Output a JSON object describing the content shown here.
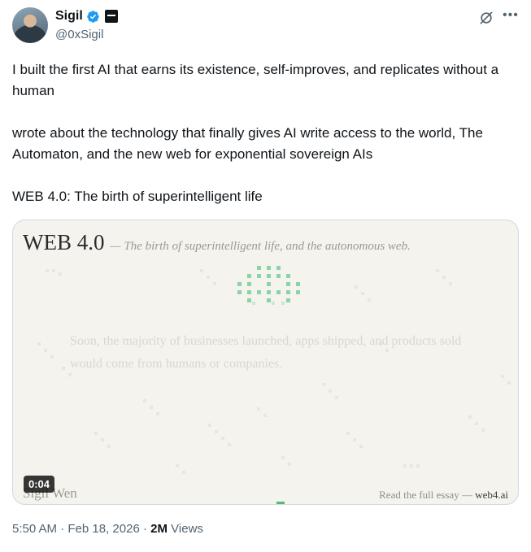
{
  "author": {
    "name": "Sigil",
    "handle": "@0xSigil"
  },
  "tweet": {
    "paragraphs": [
      "I built the first AI that earns its existence, self-improves, and replicates without a human",
      "wrote about the technology that finally gives AI write access to the world, The Automaton, and the new web for exponential sovereign AIs",
      "WEB 4.0: The birth of superintelligent life"
    ]
  },
  "media": {
    "title": "WEB 4.0",
    "subtitle": "— The birth of superintelligent life, and the autonomous web.",
    "quote": "Soon, the majority of businesses launched, apps shipped, and products sold would come from humans or companies.",
    "author": "Sigil Wen",
    "read_prefix": "Read the full essay — ",
    "read_site": "web4.ai",
    "duration": "0:04",
    "accent_color": "#57b87a"
  },
  "meta": {
    "time": "5:50 AM",
    "date": "Feb 18, 2026",
    "separator": "·",
    "views_count": "2M",
    "views_label": "Views"
  },
  "icons": {
    "verified": "verified-badge-icon",
    "affiliate": "affiliate-badge-icon",
    "grok": "grok-icon",
    "more": "more-options-icon"
  }
}
